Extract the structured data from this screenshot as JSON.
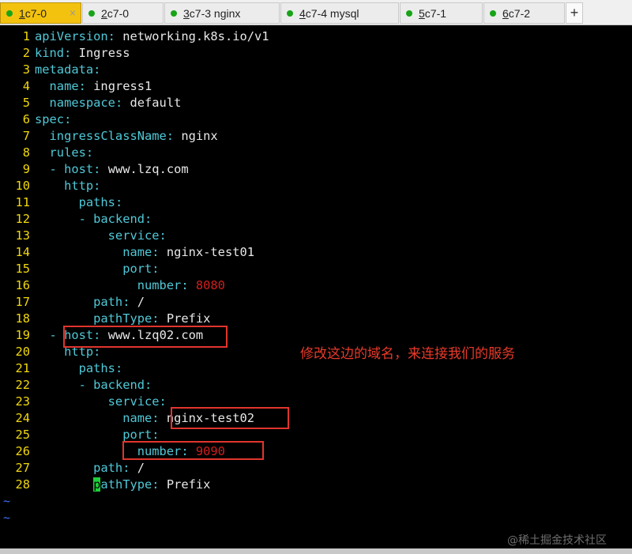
{
  "tabs": [
    {
      "num": "1",
      "label": " c7-0",
      "active": true
    },
    {
      "num": "2",
      "label": " c7-0",
      "active": false
    },
    {
      "num": "3",
      "label": " c7-3 nginx",
      "active": false
    },
    {
      "num": "4",
      "label": " c7-4 mysql",
      "active": false
    },
    {
      "num": "5",
      "label": " c7-1",
      "active": false
    },
    {
      "num": "6",
      "label": " c7-2",
      "active": false
    }
  ],
  "add_tab_label": "+",
  "close_glyph": "×",
  "editor": {
    "lines": [
      [
        {
          "t": "apiVersion",
          "c": "k"
        },
        {
          "t": ": ",
          "c": "p"
        },
        {
          "t": "networking.k8s.io/v1",
          "c": "v"
        }
      ],
      [
        {
          "t": "kind",
          "c": "k"
        },
        {
          "t": ": ",
          "c": "p"
        },
        {
          "t": "Ingress",
          "c": "v"
        }
      ],
      [
        {
          "t": "metadata",
          "c": "k"
        },
        {
          "t": ":",
          "c": "p"
        }
      ],
      [
        {
          "t": "  name",
          "c": "k"
        },
        {
          "t": ": ",
          "c": "p"
        },
        {
          "t": "ingress1",
          "c": "v"
        }
      ],
      [
        {
          "t": "  namespace",
          "c": "k"
        },
        {
          "t": ": ",
          "c": "p"
        },
        {
          "t": "default",
          "c": "v"
        }
      ],
      [
        {
          "t": "spec",
          "c": "k"
        },
        {
          "t": ":",
          "c": "p"
        }
      ],
      [
        {
          "t": "  ingressClassName",
          "c": "k"
        },
        {
          "t": ": ",
          "c": "p"
        },
        {
          "t": "nginx",
          "c": "v"
        }
      ],
      [
        {
          "t": "  rules",
          "c": "k"
        },
        {
          "t": ":",
          "c": "p"
        }
      ],
      [
        {
          "t": "  - ",
          "c": "p"
        },
        {
          "t": "host",
          "c": "k"
        },
        {
          "t": ": ",
          "c": "p"
        },
        {
          "t": "www.lzq.com",
          "c": "v"
        }
      ],
      [
        {
          "t": "    http",
          "c": "k"
        },
        {
          "t": ":",
          "c": "p"
        }
      ],
      [
        {
          "t": "      paths",
          "c": "k"
        },
        {
          "t": ":",
          "c": "p"
        }
      ],
      [
        {
          "t": "      - ",
          "c": "p"
        },
        {
          "t": "backend",
          "c": "k"
        },
        {
          "t": ":",
          "c": "p"
        }
      ],
      [
        {
          "t": "          service",
          "c": "k"
        },
        {
          "t": ":",
          "c": "p"
        }
      ],
      [
        {
          "t": "            name",
          "c": "k"
        },
        {
          "t": ": ",
          "c": "p"
        },
        {
          "t": "nginx-test01",
          "c": "v"
        }
      ],
      [
        {
          "t": "            port",
          "c": "k"
        },
        {
          "t": ":",
          "c": "p"
        }
      ],
      [
        {
          "t": "              number",
          "c": "k"
        },
        {
          "t": ": ",
          "c": "p"
        },
        {
          "t": "8080",
          "c": "n"
        }
      ],
      [
        {
          "t": "        path",
          "c": "k"
        },
        {
          "t": ": ",
          "c": "p"
        },
        {
          "t": "/",
          "c": "v"
        }
      ],
      [
        {
          "t": "        pathType",
          "c": "k"
        },
        {
          "t": ": ",
          "c": "p"
        },
        {
          "t": "Prefix",
          "c": "v"
        }
      ],
      [
        {
          "t": "  - ",
          "c": "p"
        },
        {
          "t": "host",
          "c": "k"
        },
        {
          "t": ": ",
          "c": "p"
        },
        {
          "t": "www.lzq02.com",
          "c": "v"
        }
      ],
      [
        {
          "t": "    http",
          "c": "k"
        },
        {
          "t": ":",
          "c": "p"
        }
      ],
      [
        {
          "t": "      paths",
          "c": "k"
        },
        {
          "t": ":",
          "c": "p"
        }
      ],
      [
        {
          "t": "      - ",
          "c": "p"
        },
        {
          "t": "backend",
          "c": "k"
        },
        {
          "t": ":",
          "c": "p"
        }
      ],
      [
        {
          "t": "          service",
          "c": "k"
        },
        {
          "t": ":",
          "c": "p"
        }
      ],
      [
        {
          "t": "            name",
          "c": "k"
        },
        {
          "t": ": ",
          "c": "p"
        },
        {
          "t": "nginx-test02",
          "c": "v"
        }
      ],
      [
        {
          "t": "            port",
          "c": "k"
        },
        {
          "t": ":",
          "c": "p"
        }
      ],
      [
        {
          "t": "              number",
          "c": "k"
        },
        {
          "t": ": ",
          "c": "p"
        },
        {
          "t": "9090",
          "c": "n"
        }
      ],
      [
        {
          "t": "        path",
          "c": "k"
        },
        {
          "t": ": ",
          "c": "p"
        },
        {
          "t": "/",
          "c": "v"
        }
      ],
      [
        {
          "t": "        ",
          "c": "p"
        },
        {
          "t": "p",
          "c": "cursor"
        },
        {
          "t": "athType",
          "c": "k"
        },
        {
          "t": ": ",
          "c": "p"
        },
        {
          "t": "Prefix",
          "c": "v"
        }
      ]
    ],
    "tildes": [
      "~",
      "~"
    ]
  },
  "annotation": "修改这边的域名，来连接我们的服务",
  "watermark": "@稀土掘金技术社区",
  "colors": {
    "key": "#4fc9d8",
    "value": "#e8e8e8",
    "number": "#d21e1e",
    "line_number": "#f2d80c",
    "cursor": "#1ecf3a",
    "active_tab": "#f2c20f",
    "status_dot": "#18a418",
    "annotation": "#e83a2a"
  }
}
